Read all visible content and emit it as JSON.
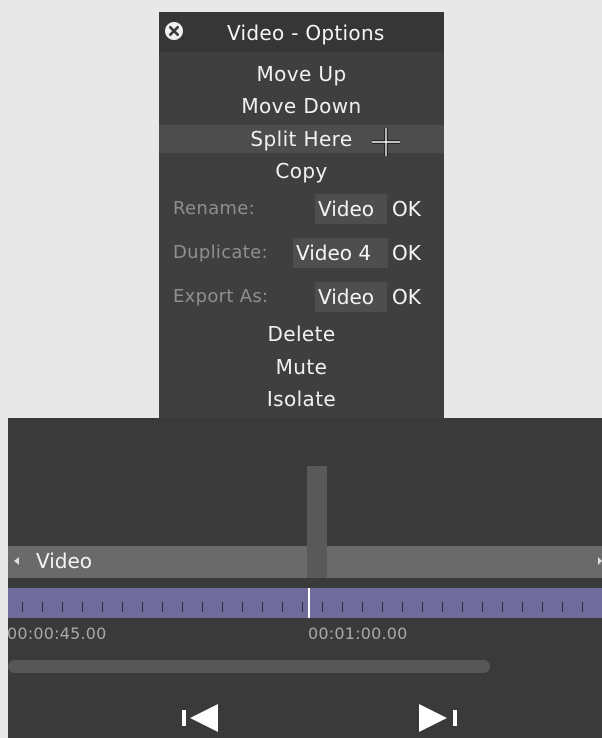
{
  "menu": {
    "title": "Video - Options",
    "items": [
      "Move Up",
      "Move Down",
      "Split Here",
      "Copy"
    ],
    "rename": {
      "label": "Rename:",
      "value": "Video",
      "ok": "OK"
    },
    "duplicate": {
      "label": "Duplicate:",
      "value": "Video 4",
      "ok": "OK"
    },
    "export": {
      "label": "Export As:",
      "value": "Video",
      "ok": "OK"
    },
    "bottom_items": [
      "Delete",
      "Mute",
      "Isolate"
    ]
  },
  "timeline": {
    "track_name": "Video",
    "timecodes": [
      "00:00:45.00",
      "00:01:00.00"
    ]
  },
  "icons": {
    "close": "close-circle-icon",
    "cursor": "crosshair-cursor-icon",
    "prev": "skip-to-start-icon",
    "next": "skip-to-end-icon"
  },
  "colors": {
    "menu_bg": "#3f3f3f",
    "panel_bg": "#3a3a3a",
    "ruler": "#6f6b9a",
    "track": "#6a6a6a"
  }
}
